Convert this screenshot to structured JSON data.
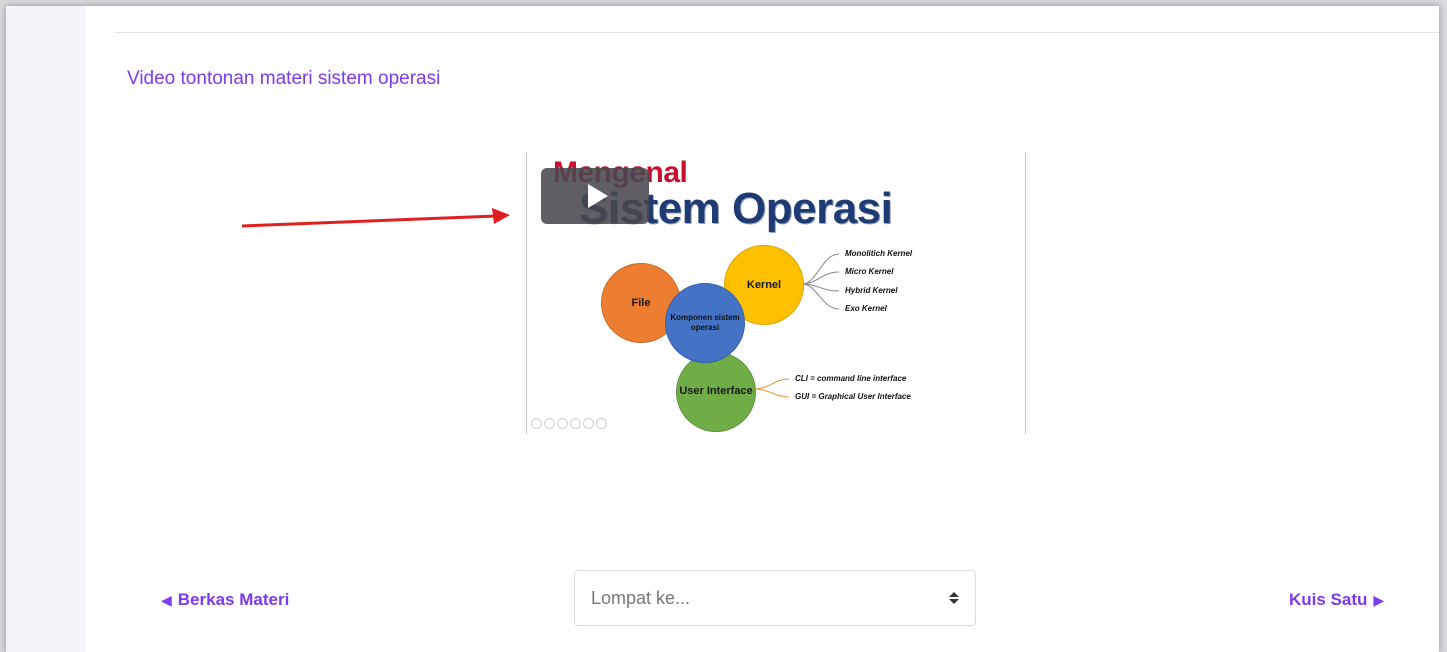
{
  "page": {
    "title": "Video tontonan materi sistem operasi"
  },
  "video": {
    "slide": {
      "kicker": "Mengenal",
      "heading": "Sistem Operasi",
      "center_node": "Komponen sistem operasi",
      "nodes": {
        "file": "File",
        "kernel": "Kernel",
        "user_interface": "User Interface"
      },
      "kernel_types": [
        "Monolitich Kernel",
        "Micro Kernel",
        "Hybrid Kernel",
        "Exo Kernel"
      ],
      "interfaces": [
        "CLI = command line interface",
        "GUI = Graphical User Interface"
      ]
    },
    "play_icon": "play-icon"
  },
  "navigation": {
    "prev_label": "Berkas Materi",
    "next_label": "Kuis Satu",
    "jump_placeholder": "Lompat ke..."
  },
  "colors": {
    "accent": "#7c3aed",
    "arrow": "#e02020"
  }
}
